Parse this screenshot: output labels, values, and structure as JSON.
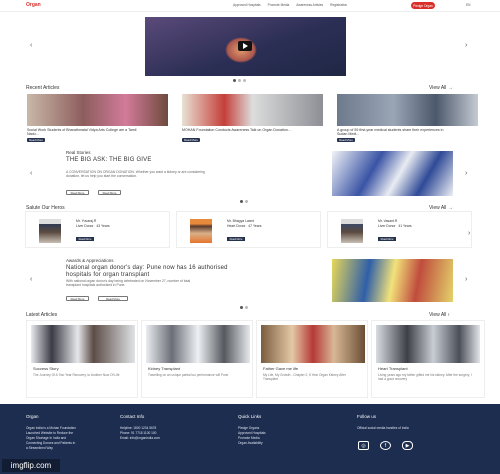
{
  "nav": {
    "logo": "Organ",
    "links": [
      "Approved Hospitals",
      "Promote Media",
      "Awareness Articles",
      "Registration"
    ],
    "pledge": "Pledge Organ",
    "lang": "EN"
  },
  "recent_articles": {
    "title": "Recent Articles",
    "view_all": "View All",
    "items": [
      {
        "caption": "Social Work Students of Bharathmatal Vidya Arts College are a Tamil Nadu...",
        "read": "Read More"
      },
      {
        "caption": "MOHAN Foundation Conducts Awareness Talk on Organ Donation...",
        "read": "Read More"
      },
      {
        "caption": "A group of 59 first-year medical students share their experiences in Sudan Medi...",
        "read": "Read More"
      }
    ]
  },
  "real_stories": {
    "heading": "Real Stories",
    "title": "THE BIG ASK: THE BIG GIVE",
    "body": "A CONVERSATION ON ORGAN DONATION. Whether you want a kidney or are considering donation, let us help you start the conversation.",
    "btn1": "Read More",
    "btn2": "Read More"
  },
  "salute": {
    "title": "Salute Our Heros",
    "view_all": "View All",
    "items": [
      {
        "name": "Mr. Yuvaraj.R",
        "type": "Liver Donor",
        "age": "43 Years",
        "read": "Read More"
      },
      {
        "name": "Mr. Bhagya Laxmi",
        "type": "Heart Donor",
        "age": "47 Years",
        "read": "Read More"
      },
      {
        "name": "Mr. Vasant.R",
        "type": "Liver Donor",
        "age": "41 Years",
        "read": "Read More"
      }
    ]
  },
  "awards": {
    "heading": "Awards & Appreciations",
    "title": "National organ donor's day: Pune now has 16 authorised hospitals for organ transplant",
    "body": "With national organ donor's day being celebrated on November 27, number of total transplant hospitals authorised in Pune.",
    "btn1": "Read More",
    "btn2": "Read More"
  },
  "latest": {
    "title": "Latest Articles",
    "view_all": "View All",
    "items": [
      {
        "title": "Success Story",
        "desc": "The Journey Of A Two Year Recovery, to Another Now Of Life"
      },
      {
        "title": "Kidney Transplant",
        "desc": "Travelling on an unique partial too performance will Pune"
      },
      {
        "title": "Father Gave me life",
        "desc": "My Life, My Growth - Chapter 2, 5 Year Organ Kidney After Transplant"
      },
      {
        "title": "Heart Transplant",
        "desc": "Living years ago my father gifted me his kidney. After the surgery, I had a good recovery"
      }
    ]
  },
  "footer": {
    "col1_title": "Organ",
    "col1_text": [
      "Organ India is a Mohan Foundation",
      "Launched Website to Reduce the",
      "Organ Shortage in India and",
      "Connecting Donors and Patients in",
      "a Streamlined Way"
    ],
    "col2_title": "Contact Info",
    "col2_text": [
      "Helpline: 1800 1234 5678",
      "Phone: 91 7718 1100 100",
      "Email: info@organindia.com"
    ],
    "col3_title": "Quick Links",
    "col3_text": [
      "Pledge Organs",
      "Approved Hospitals",
      "Promote Media",
      "Organ Availability"
    ],
    "col4_title": "Follow us",
    "col4_text": "Official social media handles of India"
  },
  "watermark": "imgflip.com",
  "colors": {
    "accent": "#d9302b",
    "dark": "#25324d",
    "footer": "#1d2d4f"
  }
}
